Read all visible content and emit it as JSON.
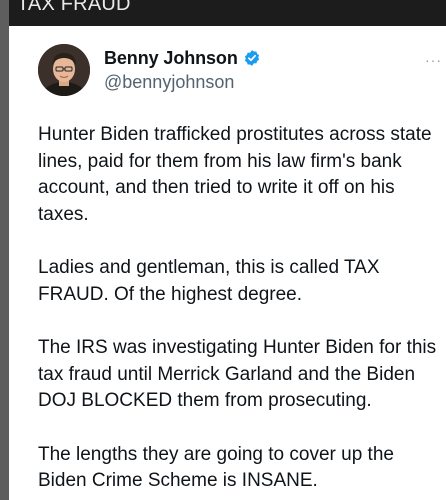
{
  "banner": {
    "label": "TAX FRAUD"
  },
  "tweet": {
    "author": {
      "display_name": "Benny Johnson",
      "handle": "@bennyjohnson"
    },
    "paragraphs": [
      "Hunter Biden trafficked prostitutes across state lines, paid for them from his law firm's bank account, and then tried to write it off on his taxes.",
      "Ladies and gentleman, this is called TAX FRAUD. Of the highest degree.",
      "The IRS was investigating Hunter Biden for this tax fraud until Merrick Garland and the Biden DOJ BLOCKED them from prosecuting.",
      "The lengths they are going to cover up the Biden Crime Scheme is INSANE."
    ],
    "more_icon": "ellipsis-icon",
    "verified_icon": "verified-badge-icon"
  },
  "colors": {
    "verified": "#1d9bf0",
    "text": "#0f1419",
    "secondary": "#536471"
  }
}
